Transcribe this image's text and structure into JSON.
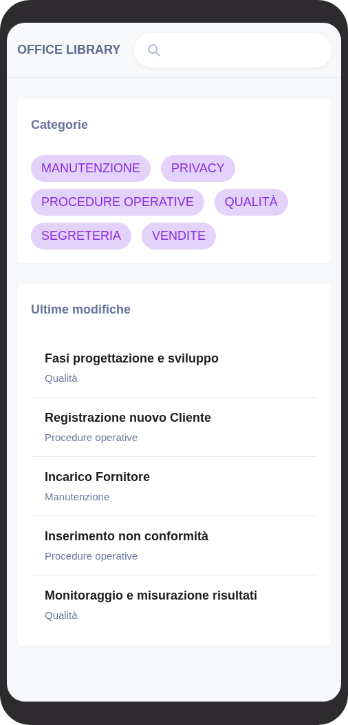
{
  "header": {
    "title": "OFFICE LIBRARY"
  },
  "categories": {
    "title": "Categorie",
    "tags": [
      "MANUTENZIONE",
      "PRIVACY",
      "PROCEDURE OPERATIVE",
      "QUALITÀ",
      "SEGRETERIA",
      "VENDITE"
    ]
  },
  "recent": {
    "title": "Ultime modifiche",
    "items": [
      {
        "title": "Fasi progettazione e sviluppo",
        "category": "Qualità"
      },
      {
        "title": "Registrazione nuovo Cliente",
        "category": "Procedure operative"
      },
      {
        "title": "Incarico Fornitore",
        "category": "Manutenzione"
      },
      {
        "title": "Inserimento non conformità",
        "category": "Procedure operative"
      },
      {
        "title": "Monitoraggio e misurazione risultati",
        "category": "Qualità"
      }
    ]
  }
}
